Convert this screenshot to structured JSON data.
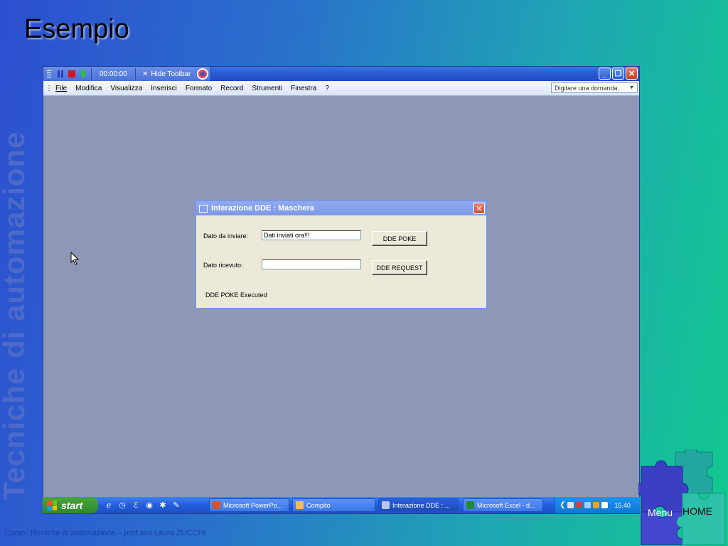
{
  "slide": {
    "title": "Esempio",
    "vertical_title": "Tecniche di automazione",
    "footer": "Corso: Tecniche di automazione – prof.ssa Laura ZUCCHI",
    "nav": {
      "menu": "Menu",
      "home": "HOME"
    }
  },
  "recorder": {
    "timer": "00:00:00",
    "hide_toolbar": "Hide Toolbar"
  },
  "menu_bar": {
    "items": [
      "File",
      "Modifica",
      "Visualizza",
      "Inserisci",
      "Formato",
      "Record",
      "Strumenti",
      "Finestra",
      "?"
    ],
    "ask_placeholder": "Digitare una domanda."
  },
  "dialog": {
    "title": "Interazione DDE : Maschera",
    "send_label": "Dato da inviare:",
    "send_value": "Dati inviati ora!!!",
    "poke_button": "DDE POKE",
    "received_label": "Dato ricevuto:",
    "received_value": "",
    "request_button": "DDE REQUEST",
    "status": "DDE POKE Executed"
  },
  "taskbar": {
    "start": "start",
    "tasks": [
      "Microsoft PowerPo...",
      "Compito",
      "Interazione DDE : ...",
      "Microsoft Excel - d..."
    ],
    "clock": "15.40"
  },
  "colors": {
    "background_start": "#2d4fd0",
    "background_end": "#12c98f",
    "xp_blue": "#245edb",
    "start_green": "#3c9a36"
  }
}
